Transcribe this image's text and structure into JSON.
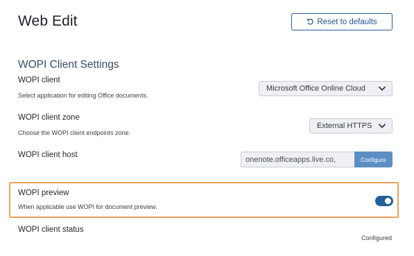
{
  "page": {
    "title": "Web Edit"
  },
  "toolbar": {
    "reset_label": "Reset to defaults",
    "reset_icon": "undo-icon"
  },
  "section": {
    "title": "WOPI Client Settings"
  },
  "wopi_client": {
    "label": "WOPI client",
    "description": "Select application for editing Office documents.",
    "selected": "Microsoft Office Online Cloud"
  },
  "wopi_zone": {
    "label": "WOPI client zone",
    "description": "Choose the WOPI client endpoints zone.",
    "selected": "External HTTPS"
  },
  "wopi_host": {
    "label": "WOPI client host",
    "value": "onenote.officeapps.live.co,",
    "configure_label": "Configure"
  },
  "wopi_preview": {
    "label": "WOPI preview",
    "description": "When applicable use WOPI for document preview.",
    "enabled": true,
    "accent": "#215f98",
    "highlight": "#f0a05a"
  },
  "wopi_status": {
    "label": "WOPI client status",
    "value": "Configured"
  }
}
